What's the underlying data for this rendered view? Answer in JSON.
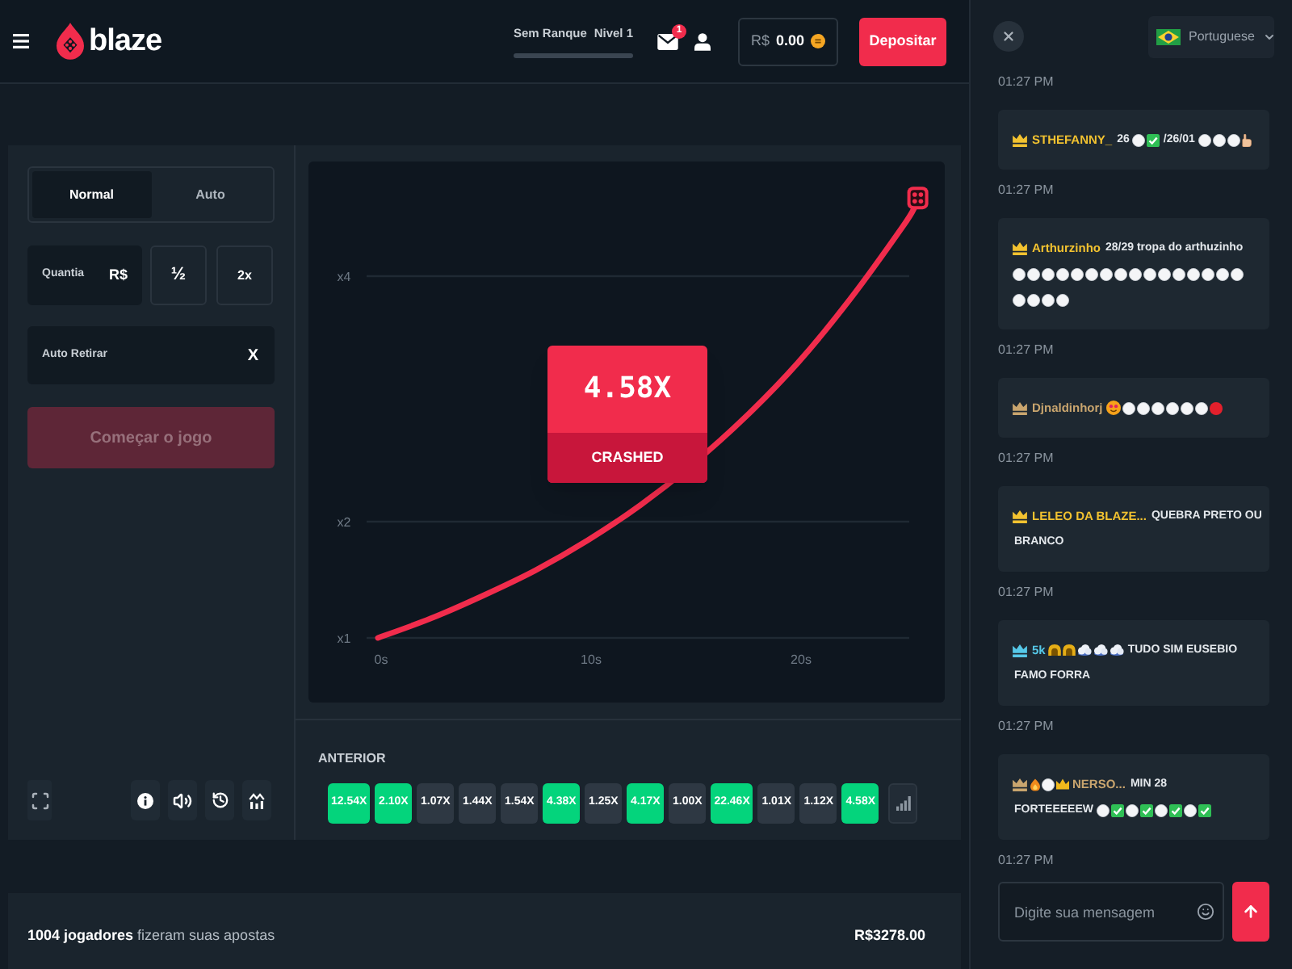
{
  "header": {
    "logo": "blaze",
    "rank": {
      "label": "Sem Ranque",
      "level_label": "Nivel 1"
    },
    "notifications": {
      "badge": "1"
    },
    "balance": {
      "currency": "R$",
      "amount": "0.00"
    },
    "deposit_button": "Depositar"
  },
  "controls": {
    "tabs": [
      {
        "label": "Normal",
        "selected": true
      },
      {
        "label": "Auto",
        "selected": false
      }
    ],
    "amount_field": {
      "label": "Quantia",
      "currency": "R$"
    },
    "half_button": "½",
    "double_button": "2x",
    "auto_cashout_field": {
      "label": "Auto Retirar",
      "clear": "X"
    },
    "start_button": {
      "label": "Começar o jogo",
      "disabled": true
    }
  },
  "game": {
    "result": {
      "multiplier": "4.58X",
      "status": "CRASHED"
    },
    "axis": {
      "y_labels": [
        "x4",
        "x2",
        "x1"
      ],
      "x_labels": [
        "0s",
        "10s",
        "20s"
      ]
    }
  },
  "history": {
    "title": "ANTERIOR",
    "entries": [
      {
        "value": "12.54X",
        "color": "#04d47c"
      },
      {
        "value": "2.10X",
        "color": "#04d47c"
      },
      {
        "value": "1.07X",
        "color": "#2e3843"
      },
      {
        "value": "1.44X",
        "color": "#2e3843"
      },
      {
        "value": "1.54X",
        "color": "#2e3843"
      },
      {
        "value": "4.38X",
        "color": "#04d47c"
      },
      {
        "value": "1.25X",
        "color": "#2e3843"
      },
      {
        "value": "4.17X",
        "color": "#04d47c"
      },
      {
        "value": "1.00X",
        "color": "#2e3843"
      },
      {
        "value": "22.46X",
        "color": "#04d47c"
      },
      {
        "value": "1.01X",
        "color": "#2e3843"
      },
      {
        "value": "1.12X",
        "color": "#2e3843"
      },
      {
        "value": "4.58X",
        "color": "#04d47c"
      }
    ]
  },
  "summary": {
    "players": "**1004 jogadores** fizeram suas apostas",
    "total": "R$3278.00"
  },
  "chat": {
    "language": "Portuguese",
    "feed": [
      {
        "kind": "time",
        "text": "01:27 PM"
      },
      {
        "kind": "message",
        "user": {
          "name": "STHEFANNY_",
          "color": "#f2c230"
        },
        "lines": [
          [
            {
              "kind": "text",
              "text": "26"
            },
            {
              "kind": "circle_white"
            },
            {
              "kind": "check"
            },
            {
              "kind": "text",
              "text": "/26/01"
            },
            {
              "kind": "circle_white"
            },
            {
              "kind": "circle_white"
            },
            {
              "kind": "circle_white"
            },
            {
              "kind": "hand"
            }
          ]
        ]
      },
      {
        "kind": "time",
        "text": "01:27 PM"
      },
      {
        "kind": "message",
        "user": {
          "name": "Arthurzinho",
          "color": "#f2c230"
        },
        "lines": [
          [
            {
              "kind": "text",
              "text": "28/29 tropa do arthuzinho"
            }
          ],
          [
            {
              "kind": "circle_white"
            },
            {
              "kind": "circle_white"
            },
            {
              "kind": "circle_white"
            },
            {
              "kind": "circle_white"
            },
            {
              "kind": "circle_white"
            },
            {
              "kind": "circle_white"
            },
            {
              "kind": "circle_white"
            },
            {
              "kind": "circle_white"
            },
            {
              "kind": "circle_white"
            },
            {
              "kind": "circle_white"
            },
            {
              "kind": "circle_white"
            },
            {
              "kind": "circle_white"
            },
            {
              "kind": "circle_white"
            },
            {
              "kind": "circle_white"
            },
            {
              "kind": "circle_white"
            },
            {
              "kind": "circle_white"
            }
          ],
          [
            {
              "kind": "circle_white"
            },
            {
              "kind": "circle_white"
            },
            {
              "kind": "circle_white"
            },
            {
              "kind": "circle_white"
            }
          ]
        ]
      },
      {
        "kind": "time",
        "text": "01:27 PM"
      },
      {
        "kind": "message",
        "user": {
          "name": "Djnaldinhorj",
          "color": "#c9a56e"
        },
        "lines": [
          [
            {
              "kind": "face"
            },
            {
              "kind": "circle_white"
            },
            {
              "kind": "circle_white"
            },
            {
              "kind": "circle_white"
            },
            {
              "kind": "circle_white"
            },
            {
              "kind": "circle_white"
            },
            {
              "kind": "circle_white"
            },
            {
              "kind": "circle_red"
            }
          ]
        ]
      },
      {
        "kind": "time",
        "text": "01:27 PM"
      },
      {
        "kind": "message",
        "user": {
          "name": "LELEO DA BLAZE...",
          "color": "#f2c230"
        },
        "lines": [
          [
            {
              "kind": "text",
              "text": "QUEBRA PRETO OU"
            }
          ],
          [
            {
              "kind": "text",
              "text": "BRANCO"
            }
          ]
        ]
      },
      {
        "kind": "time",
        "text": "01:27 PM"
      },
      {
        "kind": "message",
        "user": {
          "name": "5k",
          "color": "#56c8e8"
        },
        "lines": [
          [
            {
              "kind": "dome"
            },
            {
              "kind": "dome"
            },
            {
              "kind": "cloud"
            },
            {
              "kind": "cloud"
            },
            {
              "kind": "cloud"
            },
            {
              "kind": "text",
              "text": "TUDO SIM EUSEBIO"
            }
          ],
          [
            {
              "kind": "text",
              "text": "FAMO FORRA"
            }
          ]
        ]
      },
      {
        "kind": "time",
        "text": "01:27 PM"
      },
      {
        "kind": "message",
        "user": {
          "name": "NERSO...",
          "color": "#c9a56e",
          "name_prefix": [
            {
              "kind": "flame"
            },
            {
              "kind": "circle_white"
            },
            {
              "kind": "crown"
            }
          ]
        },
        "lines": [
          [
            {
              "kind": "text",
              "text": "MIN 28"
            }
          ],
          [
            {
              "kind": "text",
              "text": "FORTEEEEEW"
            },
            {
              "kind": "circle_white"
            },
            {
              "kind": "check"
            },
            {
              "kind": "circle_white"
            },
            {
              "kind": "check"
            },
            {
              "kind": "circle_white"
            },
            {
              "kind": "check"
            },
            {
              "kind": "circle_white"
            },
            {
              "kind": "check"
            }
          ]
        ]
      },
      {
        "kind": "time",
        "text": "01:27 PM"
      }
    ],
    "input": {
      "placeholder": "Digite sua mensagem"
    }
  }
}
